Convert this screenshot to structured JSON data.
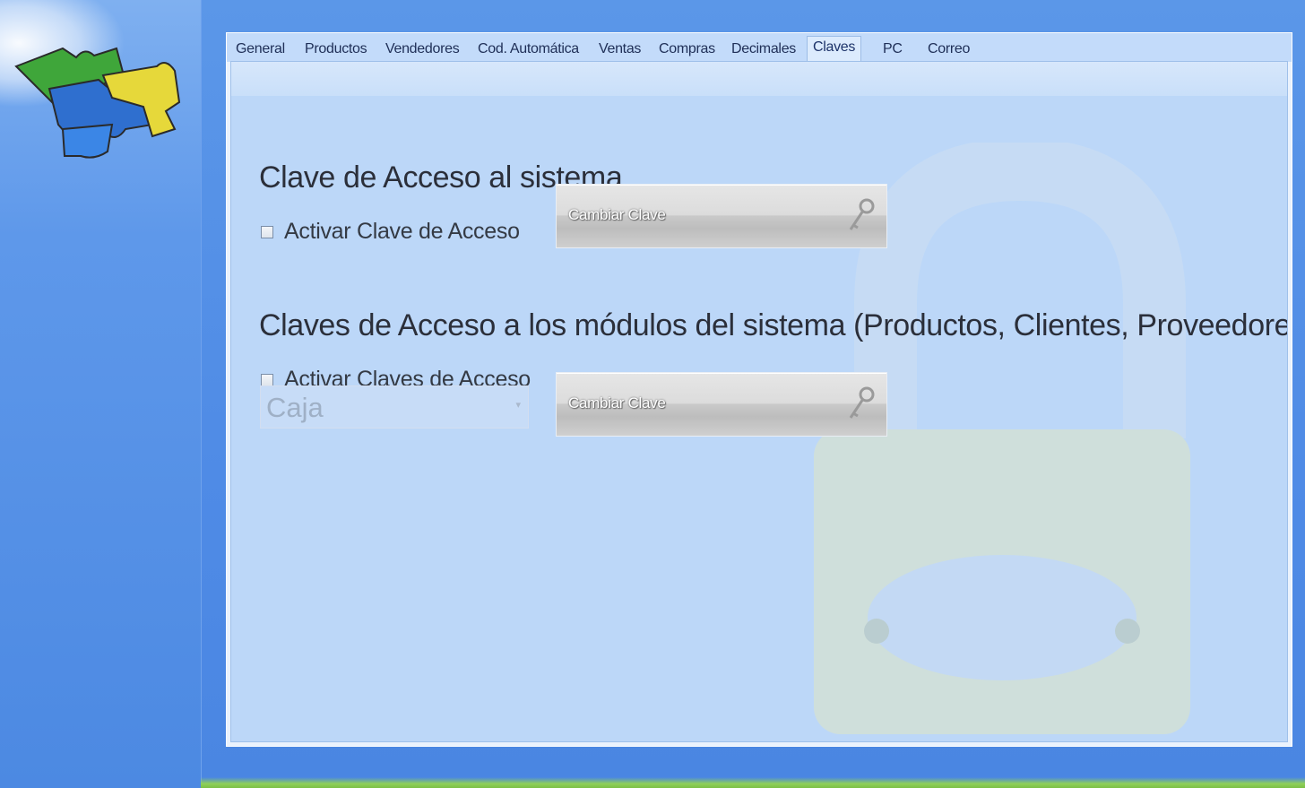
{
  "tabs": [
    {
      "label": "General"
    },
    {
      "label": "Productos"
    },
    {
      "label": "Vendedores"
    },
    {
      "label": "Cod. Automática"
    },
    {
      "label": "Ventas"
    },
    {
      "label": "Compras"
    },
    {
      "label": "Decimales"
    },
    {
      "label": "Claves",
      "active": true
    },
    {
      "label": "PC"
    },
    {
      "label": "Correo"
    }
  ],
  "section_system": {
    "title": "Clave de Acceso al sistema",
    "checkbox_label": "Activar Clave de Acceso",
    "checked": false,
    "button_label": "Cambiar Clave"
  },
  "section_modules": {
    "title": "Claves de Acceso a los módulos del sistema (Productos, Clientes, Proveedores, etc)",
    "checkbox_label": "Activar Claves de Acceso",
    "checked": false,
    "select_value": "Caja",
    "button_label": "Cambiar Clave"
  },
  "icons": {
    "logo": "puzzle-pieces-logo",
    "background": "padlock-watermark",
    "button": "key-icon"
  }
}
